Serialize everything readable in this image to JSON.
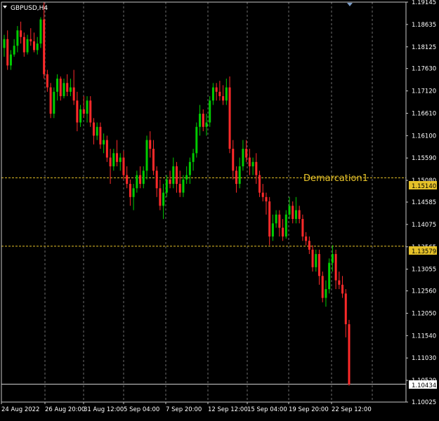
{
  "window": {
    "title": "GBPUSD,H4"
  },
  "colors": {
    "background": "#000000",
    "frame": "#c8c8c8",
    "grid": "#c8c8c8",
    "bull": "#00cc00",
    "bear": "#ff2a2a",
    "line_level": "#e6c229",
    "label_text": "#e6c229",
    "text": "#ffffff"
  },
  "annotations": {
    "demarcation_name": "Demarcation1",
    "level_upper": "1.15140",
    "level_lower": "1.13579",
    "current_price": "1.10434"
  },
  "chart_data": {
    "type": "candlestick",
    "symbol": "GBPUSD",
    "timeframe": "H4",
    "ylim": [
      1.10025,
      1.19145
    ],
    "y_ticks": [
      "1.19145",
      "1.18635",
      "1.18125",
      "1.17630",
      "1.17120",
      "1.16610",
      "1.16100",
      "1.15590",
      "1.15080",
      "1.14585",
      "1.14075",
      "1.13565",
      "1.13055",
      "1.12560",
      "1.12050",
      "1.11540",
      "1.11030",
      "1.10520",
      "1.10025"
    ],
    "x_ticks": [
      "24 Aug 2022",
      "26 Aug 20:00",
      "31 Aug 12:00",
      "5 Sep 04:00",
      "7 Sep 20:00",
      "12 Sep 12:00",
      "15 Sep 04:00",
      "19 Sep 20:00",
      "22 Sep 12:00"
    ],
    "horizontal_lines": [
      1.1514,
      1.13579,
      1.10434
    ],
    "candles": [
      {
        "o": 1.181,
        "h": 1.184,
        "l": 1.179,
        "c": 1.183
      },
      {
        "o": 1.183,
        "h": 1.185,
        "l": 1.176,
        "c": 1.177
      },
      {
        "o": 1.177,
        "h": 1.1805,
        "l": 1.176,
        "c": 1.1795
      },
      {
        "o": 1.1795,
        "h": 1.183,
        "l": 1.179,
        "c": 1.1815
      },
      {
        "o": 1.1815,
        "h": 1.186,
        "l": 1.18,
        "c": 1.185
      },
      {
        "o": 1.185,
        "h": 1.187,
        "l": 1.182,
        "c": 1.1835
      },
      {
        "o": 1.1835,
        "h": 1.1845,
        "l": 1.179,
        "c": 1.18
      },
      {
        "o": 1.18,
        "h": 1.184,
        "l": 1.1795,
        "c": 1.183
      },
      {
        "o": 1.183,
        "h": 1.1855,
        "l": 1.1815,
        "c": 1.1825
      },
      {
        "o": 1.1825,
        "h": 1.1845,
        "l": 1.18,
        "c": 1.1805
      },
      {
        "o": 1.1805,
        "h": 1.1835,
        "l": 1.1795,
        "c": 1.182
      },
      {
        "o": 1.182,
        "h": 1.188,
        "l": 1.181,
        "c": 1.1875
      },
      {
        "o": 1.1875,
        "h": 1.1915,
        "l": 1.174,
        "c": 1.175
      },
      {
        "o": 1.175,
        "h": 1.176,
        "l": 1.171,
        "c": 1.172
      },
      {
        "o": 1.172,
        "h": 1.173,
        "l": 1.165,
        "c": 1.166
      },
      {
        "o": 1.166,
        "h": 1.172,
        "l": 1.165,
        "c": 1.171
      },
      {
        "o": 1.171,
        "h": 1.175,
        "l": 1.169,
        "c": 1.174
      },
      {
        "o": 1.174,
        "h": 1.1745,
        "l": 1.169,
        "c": 1.17
      },
      {
        "o": 1.17,
        "h": 1.174,
        "l": 1.1695,
        "c": 1.173
      },
      {
        "o": 1.173,
        "h": 1.175,
        "l": 1.17,
        "c": 1.171
      },
      {
        "o": 1.171,
        "h": 1.174,
        "l": 1.17,
        "c": 1.172
      },
      {
        "o": 1.172,
        "h": 1.176,
        "l": 1.168,
        "c": 1.169
      },
      {
        "o": 1.169,
        "h": 1.171,
        "l": 1.162,
        "c": 1.164
      },
      {
        "o": 1.164,
        "h": 1.168,
        "l": 1.163,
        "c": 1.167
      },
      {
        "o": 1.167,
        "h": 1.17,
        "l": 1.165,
        "c": 1.166
      },
      {
        "o": 1.166,
        "h": 1.17,
        "l": 1.164,
        "c": 1.169
      },
      {
        "o": 1.169,
        "h": 1.17,
        "l": 1.163,
        "c": 1.164
      },
      {
        "o": 1.164,
        "h": 1.165,
        "l": 1.159,
        "c": 1.161
      },
      {
        "o": 1.161,
        "h": 1.164,
        "l": 1.16,
        "c": 1.163
      },
      {
        "o": 1.163,
        "h": 1.164,
        "l": 1.158,
        "c": 1.159
      },
      {
        "o": 1.159,
        "h": 1.1615,
        "l": 1.157,
        "c": 1.16
      },
      {
        "o": 1.16,
        "h": 1.161,
        "l": 1.155,
        "c": 1.156
      },
      {
        "o": 1.156,
        "h": 1.158,
        "l": 1.15,
        "c": 1.154
      },
      {
        "o": 1.154,
        "h": 1.158,
        "l": 1.153,
        "c": 1.157
      },
      {
        "o": 1.157,
        "h": 1.16,
        "l": 1.154,
        "c": 1.155
      },
      {
        "o": 1.155,
        "h": 1.157,
        "l": 1.153,
        "c": 1.156
      },
      {
        "o": 1.156,
        "h": 1.1575,
        "l": 1.151,
        "c": 1.152
      },
      {
        "o": 1.152,
        "h": 1.154,
        "l": 1.149,
        "c": 1.15
      },
      {
        "o": 1.15,
        "h": 1.151,
        "l": 1.145,
        "c": 1.147
      },
      {
        "o": 1.147,
        "h": 1.15,
        "l": 1.144,
        "c": 1.149
      },
      {
        "o": 1.149,
        "h": 1.153,
        "l": 1.148,
        "c": 1.152
      },
      {
        "o": 1.152,
        "h": 1.154,
        "l": 1.149,
        "c": 1.15
      },
      {
        "o": 1.15,
        "h": 1.154,
        "l": 1.149,
        "c": 1.153
      },
      {
        "o": 1.153,
        "h": 1.161,
        "l": 1.151,
        "c": 1.16
      },
      {
        "o": 1.16,
        "h": 1.162,
        "l": 1.156,
        "c": 1.158
      },
      {
        "o": 1.158,
        "h": 1.16,
        "l": 1.152,
        "c": 1.153
      },
      {
        "o": 1.153,
        "h": 1.154,
        "l": 1.147,
        "c": 1.149
      },
      {
        "o": 1.149,
        "h": 1.151,
        "l": 1.144,
        "c": 1.145
      },
      {
        "o": 1.145,
        "h": 1.15,
        "l": 1.142,
        "c": 1.148
      },
      {
        "o": 1.148,
        "h": 1.152,
        "l": 1.147,
        "c": 1.151
      },
      {
        "o": 1.151,
        "h": 1.153,
        "l": 1.149,
        "c": 1.15
      },
      {
        "o": 1.15,
        "h": 1.156,
        "l": 1.149,
        "c": 1.154
      },
      {
        "o": 1.154,
        "h": 1.155,
        "l": 1.148,
        "c": 1.15
      },
      {
        "o": 1.15,
        "h": 1.153,
        "l": 1.147,
        "c": 1.148
      },
      {
        "o": 1.148,
        "h": 1.152,
        "l": 1.147,
        "c": 1.151
      },
      {
        "o": 1.151,
        "h": 1.154,
        "l": 1.15,
        "c": 1.152
      },
      {
        "o": 1.152,
        "h": 1.156,
        "l": 1.15,
        "c": 1.155
      },
      {
        "o": 1.155,
        "h": 1.158,
        "l": 1.153,
        "c": 1.157
      },
      {
        "o": 1.157,
        "h": 1.164,
        "l": 1.156,
        "c": 1.163
      },
      {
        "o": 1.163,
        "h": 1.168,
        "l": 1.161,
        "c": 1.166
      },
      {
        "o": 1.166,
        "h": 1.167,
        "l": 1.162,
        "c": 1.163
      },
      {
        "o": 1.163,
        "h": 1.166,
        "l": 1.161,
        "c": 1.164
      },
      {
        "o": 1.164,
        "h": 1.17,
        "l": 1.163,
        "c": 1.169
      },
      {
        "o": 1.169,
        "h": 1.173,
        "l": 1.168,
        "c": 1.172
      },
      {
        "o": 1.172,
        "h": 1.173,
        "l": 1.169,
        "c": 1.171
      },
      {
        "o": 1.171,
        "h": 1.1735,
        "l": 1.169,
        "c": 1.17
      },
      {
        "o": 1.17,
        "h": 1.1725,
        "l": 1.168,
        "c": 1.169
      },
      {
        "o": 1.169,
        "h": 1.174,
        "l": 1.168,
        "c": 1.172
      },
      {
        "o": 1.172,
        "h": 1.1745,
        "l": 1.157,
        "c": 1.158
      },
      {
        "o": 1.158,
        "h": 1.16,
        "l": 1.151,
        "c": 1.153
      },
      {
        "o": 1.153,
        "h": 1.154,
        "l": 1.148,
        "c": 1.15
      },
      {
        "o": 1.15,
        "h": 1.156,
        "l": 1.149,
        "c": 1.154
      },
      {
        "o": 1.154,
        "h": 1.16,
        "l": 1.153,
        "c": 1.158
      },
      {
        "o": 1.158,
        "h": 1.16,
        "l": 1.155,
        "c": 1.156
      },
      {
        "o": 1.156,
        "h": 1.158,
        "l": 1.152,
        "c": 1.154
      },
      {
        "o": 1.154,
        "h": 1.156,
        "l": 1.152,
        "c": 1.155
      },
      {
        "o": 1.155,
        "h": 1.157,
        "l": 1.15,
        "c": 1.152
      },
      {
        "o": 1.152,
        "h": 1.153,
        "l": 1.147,
        "c": 1.148
      },
      {
        "o": 1.148,
        "h": 1.15,
        "l": 1.146,
        "c": 1.147
      },
      {
        "o": 1.147,
        "h": 1.148,
        "l": 1.143,
        "c": 1.146
      },
      {
        "o": 1.146,
        "h": 1.147,
        "l": 1.136,
        "c": 1.138
      },
      {
        "o": 1.138,
        "h": 1.143,
        "l": 1.137,
        "c": 1.141
      },
      {
        "o": 1.141,
        "h": 1.144,
        "l": 1.14,
        "c": 1.143
      },
      {
        "o": 1.143,
        "h": 1.144,
        "l": 1.138,
        "c": 1.14
      },
      {
        "o": 1.14,
        "h": 1.142,
        "l": 1.137,
        "c": 1.138
      },
      {
        "o": 1.138,
        "h": 1.144,
        "l": 1.1375,
        "c": 1.143
      },
      {
        "o": 1.143,
        "h": 1.147,
        "l": 1.142,
        "c": 1.145
      },
      {
        "o": 1.145,
        "h": 1.146,
        "l": 1.141,
        "c": 1.142
      },
      {
        "o": 1.142,
        "h": 1.147,
        "l": 1.141,
        "c": 1.144
      },
      {
        "o": 1.144,
        "h": 1.145,
        "l": 1.141,
        "c": 1.142
      },
      {
        "o": 1.142,
        "h": 1.143,
        "l": 1.137,
        "c": 1.138
      },
      {
        "o": 1.138,
        "h": 1.139,
        "l": 1.136,
        "c": 1.137
      },
      {
        "o": 1.137,
        "h": 1.138,
        "l": 1.134,
        "c": 1.135
      },
      {
        "o": 1.135,
        "h": 1.136,
        "l": 1.13,
        "c": 1.131
      },
      {
        "o": 1.131,
        "h": 1.135,
        "l": 1.13,
        "c": 1.134
      },
      {
        "o": 1.134,
        "h": 1.135,
        "l": 1.127,
        "c": 1.129
      },
      {
        "o": 1.129,
        "h": 1.13,
        "l": 1.123,
        "c": 1.124
      },
      {
        "o": 1.124,
        "h": 1.128,
        "l": 1.122,
        "c": 1.126
      },
      {
        "o": 1.126,
        "h": 1.133,
        "l": 1.125,
        "c": 1.132
      },
      {
        "o": 1.132,
        "h": 1.136,
        "l": 1.13,
        "c": 1.134
      },
      {
        "o": 1.134,
        "h": 1.135,
        "l": 1.126,
        "c": 1.128
      },
      {
        "o": 1.128,
        "h": 1.13,
        "l": 1.126,
        "c": 1.127
      },
      {
        "o": 1.127,
        "h": 1.129,
        "l": 1.124,
        "c": 1.125
      },
      {
        "o": 1.125,
        "h": 1.126,
        "l": 1.115,
        "c": 1.118
      },
      {
        "o": 1.118,
        "h": 1.119,
        "l": 1.104,
        "c": 1.1043
      }
    ]
  }
}
